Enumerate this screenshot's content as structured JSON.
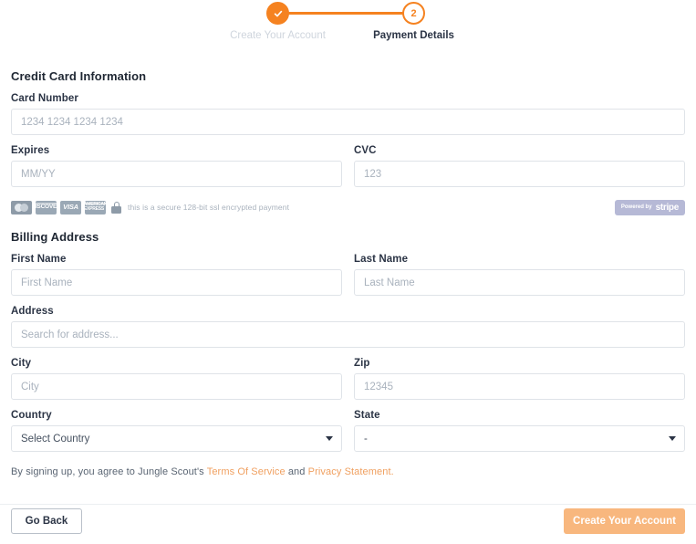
{
  "stepper": {
    "steps": [
      {
        "label": "Create Your Account",
        "state": "done",
        "marker": "check-icon"
      },
      {
        "label": "Payment Details",
        "state": "current",
        "marker": "2"
      }
    ]
  },
  "credit_card": {
    "title": "Credit Card Information",
    "card_number": {
      "label": "Card Number",
      "placeholder": "1234 1234 1234 1234",
      "value": ""
    },
    "expires": {
      "label": "Expires",
      "placeholder": "MM/YY",
      "value": ""
    },
    "cvc": {
      "label": "CVC",
      "placeholder": "123",
      "value": ""
    }
  },
  "secure": {
    "text": "this is a secure 128-bit ssl encrypted payment",
    "cards": [
      "mastercard",
      "discover",
      "visa",
      "amex"
    ],
    "lock_icon": "lock-icon",
    "stripe": {
      "powered_by": "Powered by",
      "brand": "stripe"
    }
  },
  "billing": {
    "title": "Billing Address",
    "first_name": {
      "label": "First Name",
      "placeholder": "First Name",
      "value": ""
    },
    "last_name": {
      "label": "Last Name",
      "placeholder": "Last Name",
      "value": ""
    },
    "address": {
      "label": "Address",
      "placeholder": "Search for address...",
      "value": ""
    },
    "city": {
      "label": "City",
      "placeholder": "City",
      "value": ""
    },
    "zip": {
      "label": "Zip",
      "placeholder": "12345",
      "value": ""
    },
    "country": {
      "label": "Country",
      "selected": "Select Country"
    },
    "state": {
      "label": "State",
      "selected": "-"
    }
  },
  "legal": {
    "prefix": "By signing up, you agree to Jungle Scout's ",
    "terms": "Terms Of Service",
    "middle": " and ",
    "privacy": "Privacy Statement."
  },
  "footer": {
    "back_label": "Go Back",
    "submit_label": "Create Your Account"
  },
  "colors": {
    "accent": "#f58220",
    "submit_disabled": "#f8b77e",
    "link": "#f0a060",
    "border": "#dfe3e8",
    "placeholder": "#a9b2bd",
    "muted": "#cfd5dd"
  }
}
